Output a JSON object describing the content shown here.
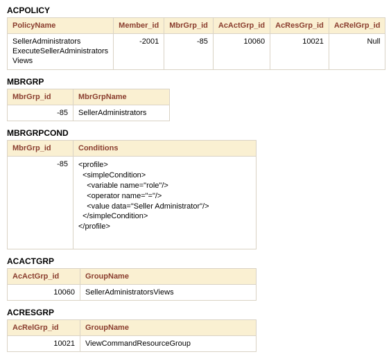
{
  "acpolicy": {
    "title": "ACPOLICY",
    "headers": [
      "PolicyName",
      "Member_id",
      "MbrGrp_id",
      "AcActGrp_id",
      "AcResGrp_id",
      "AcRelGrp_id"
    ],
    "row": {
      "policyName": "SellerAdministrators\nExecuteSellerAdministrators\nViews",
      "memberId": "-2001",
      "mbrGrpId": "-85",
      "acActGrpId": "10060",
      "acResGrpId": "10021",
      "acRelGrpId": "Null"
    }
  },
  "mbrgrp": {
    "title": "MBRGRP",
    "headers": [
      "MbrGrp_id",
      "MbrGrpName"
    ],
    "row": {
      "id": "-85",
      "name": "SellerAdministrators"
    }
  },
  "mbrgrpcond": {
    "title": "MBRGRPCOND",
    "headers": [
      "MbrGrp_id",
      "Conditions"
    ],
    "row": {
      "id": "-85",
      "conditions": "<profile>\n  <simpleCondition>\n    <variable name=\"role\"/>\n    <operator name=\"=\"/>\n    <value data=\"Seller Administrator\"/>\n  </simpleCondition>\n</profile>"
    }
  },
  "acactgrp": {
    "title": "ACACTGRP",
    "headers": [
      "AcActGrp_id",
      "GroupName"
    ],
    "row": {
      "id": "10060",
      "name": "SellerAdministratorsViews"
    }
  },
  "acresgrp": {
    "title": "ACRESGRP",
    "headers": [
      "AcRelGrp_id",
      "GroupName"
    ],
    "row": {
      "id": "10021",
      "name": "ViewCommandResourceGroup"
    }
  }
}
